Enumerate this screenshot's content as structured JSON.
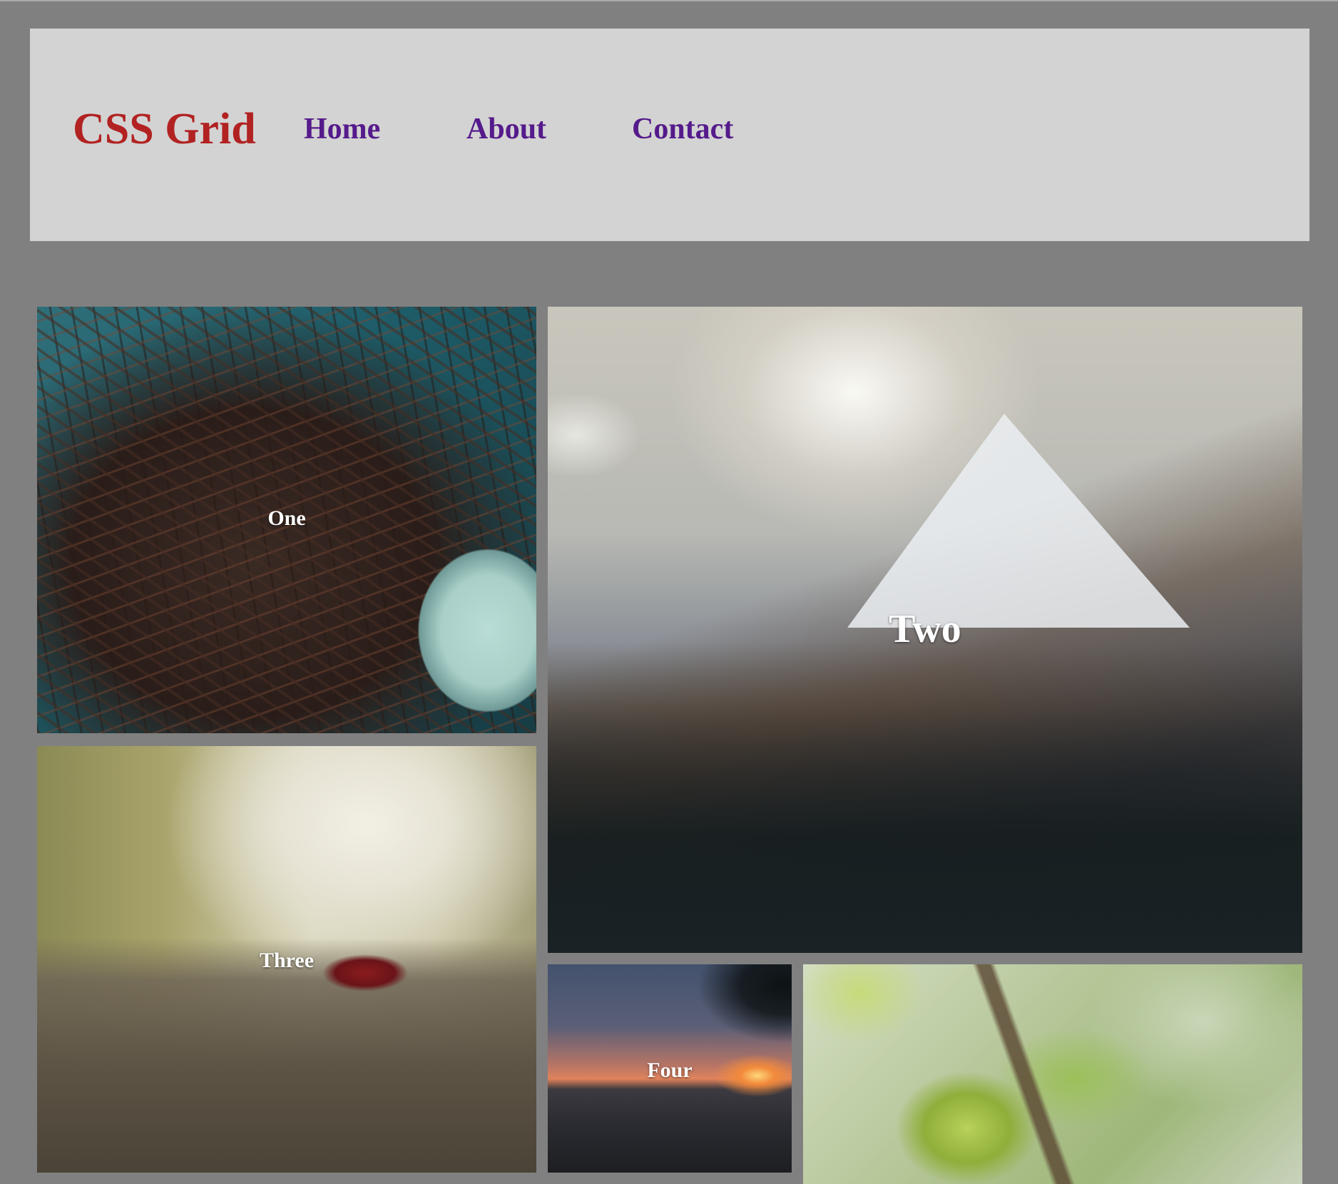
{
  "header": {
    "logo": "CSS Grid",
    "nav": [
      {
        "label": "Home"
      },
      {
        "label": "About"
      },
      {
        "label": "Contact"
      }
    ]
  },
  "grid": {
    "tiles": [
      {
        "caption": "One"
      },
      {
        "caption": "Two"
      },
      {
        "caption": "Three"
      },
      {
        "caption": "Four"
      },
      {
        "caption": ""
      }
    ]
  },
  "colors": {
    "page_background": "#808080",
    "header_background": "#d3d3d3",
    "logo": "#b22222",
    "nav_link": "#551a8b",
    "caption": "#ffffff"
  }
}
